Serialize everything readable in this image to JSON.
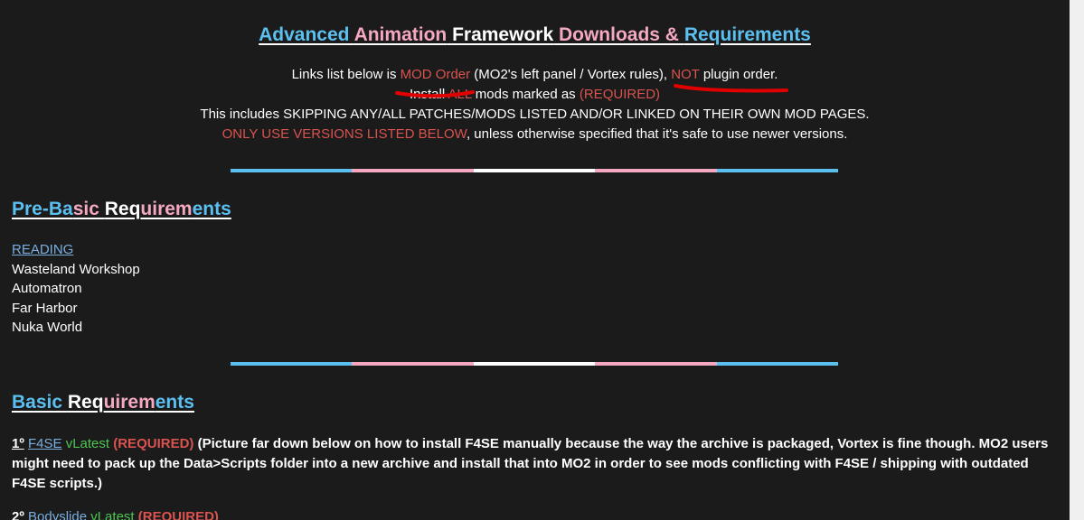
{
  "title": {
    "word1": "Advanced",
    "word2": "Animation",
    "word3": "Framework",
    "word4": "Downloads &",
    "word5": "Requirements"
  },
  "intro": {
    "line1_prefix": "Links list below is ",
    "line1_mod_order": "MOD Order",
    "line1_middle": " (MO2's left panel / Vortex rules), ",
    "line1_not": "NOT",
    "line1_suffix": " plugin order.",
    "line2_prefix": "Install ",
    "line2_all": "ALL",
    "line2_middle": " mods marked as ",
    "line2_required": "(REQUIRED)",
    "line3": "This includes SKIPPING ANY/ALL PATCHES/MODS LISTED AND/OR LINKED ON THEIR OWN MOD PAGES.",
    "line4_red": "ONLY USE VERSIONS LISTED BELOW",
    "line4_rest": ", unless otherwise specified that it's safe to use newer versions."
  },
  "divider_colors": [
    "#5bc0f0",
    "#f4a9c0",
    "#ffffff",
    "#f4a9c0",
    "#5bc0f0"
  ],
  "prebasic": {
    "title_parts": [
      "Pre-Ba",
      "sic ",
      "Req",
      "uirem",
      "ents"
    ],
    "items": [
      {
        "label": "READING",
        "link": true
      },
      {
        "label": "Wasteland Workshop",
        "link": false
      },
      {
        "label": "Automatron",
        "link": false
      },
      {
        "label": "Far Harbor",
        "link": false
      },
      {
        "label": "Nuka World",
        "link": false
      }
    ]
  },
  "basic": {
    "title_parts": [
      "Basic ",
      "Req",
      "uirem",
      "ents"
    ],
    "item1": {
      "num": "1º",
      "name": "F4SE",
      "version": "vLatest",
      "required": "(REQUIRED)",
      "note": "(Picture far down below on how to install F4SE manually because the way the archive is packaged, Vortex is fine though. MO2 users might need to pack up the Data>Scripts folder into a new archive and install that into MO2 in order to see mods conflicting with F4SE / shipping with outdated F4SE scripts.)"
    },
    "item2": {
      "num": "2º",
      "name": "Bodyslide",
      "version": "vLatest",
      "required": "(REQUIRED)"
    }
  },
  "colors": {
    "background": "#1b1b1b",
    "blue": "#5bc0f0",
    "pink": "#f4a9c0",
    "red": "#d9534f",
    "green": "#4cc552",
    "annotation": "#e00000"
  }
}
